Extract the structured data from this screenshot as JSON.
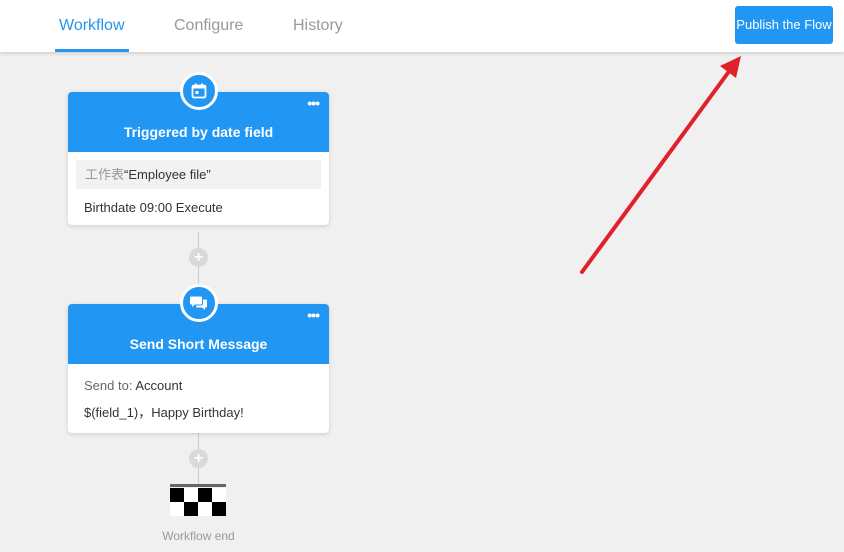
{
  "tabs": [
    {
      "label": "Workflow",
      "active": true
    },
    {
      "label": "Configure",
      "active": false
    },
    {
      "label": "History",
      "active": false
    }
  ],
  "publish_label": "Publish the Flow",
  "nodes": [
    {
      "icon": "calendar-icon",
      "title": "Triggered by date field",
      "more": "•••",
      "table_prefix": "工作表",
      "table_name": "“Employee file”",
      "line": "Birthdate 09:00 Execute"
    },
    {
      "icon": "chat-icon",
      "title": "Send Short Message",
      "more": "•••",
      "send_to_label": "Send to: ",
      "send_to_value": "Account",
      "message": "$(field_1)，Happy Birthday!"
    }
  ],
  "add_label": "+",
  "end": {
    "icon": "checkered-flag-icon",
    "label": "Workflow end"
  },
  "colors": {
    "accent": "#2196f3",
    "annotation": "#e0202a"
  }
}
